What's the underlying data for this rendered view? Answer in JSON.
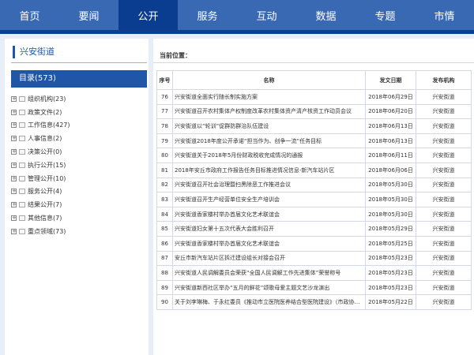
{
  "nav": [
    "首页",
    "要闻",
    "公开",
    "服务",
    "互动",
    "数据",
    "专题",
    "市情"
  ],
  "sidebar": {
    "title": "兴安街道",
    "catalog": "目录(573)",
    "items": [
      "组织机构(23)",
      "政策文件(2)",
      "工作信息(427)",
      "人事信息(2)",
      "决策公开(0)",
      "执行公开(15)",
      "管理公开(10)",
      "服务公开(4)",
      "结果公开(7)",
      "其他信息(7)",
      "重点领域(73)"
    ]
  },
  "main": {
    "crumb": "当前位置：",
    "headers": [
      "序号",
      "名称",
      "发文日期",
      "发布机构"
    ],
    "rows": [
      [
        "76",
        "兴安街道全面实行随长制实施方案",
        "2018年06月29日",
        "兴安街道"
      ],
      [
        "77",
        "兴安街道召开农村集体产权制度改革农村集体资产清产核资工作动员会议",
        "2018年06月20日",
        "兴安街道"
      ],
      [
        "78",
        "兴安街道以“轮训”促群防群治队伍建设",
        "2018年06月13日",
        "兴安街道"
      ],
      [
        "79",
        "兴安街道2018年度公开承诺“担当作为、创争一流”任务目标",
        "2018年06月13日",
        "兴安街道"
      ],
      [
        "80",
        "兴安街道关于2018年5月份财政税收完成情况的通报",
        "2018年06月11日",
        "兴安街道"
      ],
      [
        "81",
        "2018年安丘市政府工作报告任务目标推进情况信息-新汽车站片区",
        "2018年06月06日",
        "兴安街道"
      ],
      [
        "82",
        "兴安街道召开社会治理暨扫黑除恶工作推进会议",
        "2018年05月30日",
        "兴安街道"
      ],
      [
        "83",
        "兴安街道召开生产经营单位安全生产培训会",
        "2018年05月30日",
        "兴安街道"
      ],
      [
        "84",
        "兴安街道香家楼村举办首届文化艺术联谊会",
        "2018年05月30日",
        "兴安街道"
      ],
      [
        "85",
        "兴安街道妇女第十五次代表大会胜利召开",
        "2018年05月29日",
        "兴安街道"
      ],
      [
        "86",
        "兴安街道香家楼村举办首届文化艺术联谊会",
        "2018年05月25日",
        "兴安街道"
      ],
      [
        "87",
        "安丘市新汽车站片区拆迁建设组长对接会召开",
        "2018年05月23日",
        "兴安街道"
      ],
      [
        "88",
        "兴安街道人民调解委员会荣获“全国人民调解工作先进集体”荣誉称号",
        "2018年05月23日",
        "兴安街道"
      ],
      [
        "89",
        "兴安街道新西社区举办“五月的鲜花”颂歌母爱主题文艺沙龙演出",
        "2018年05月23日",
        "兴安街道"
      ],
      [
        "90",
        "关于刘李琳梅、于永红委员《推动市立医院医养结合型医院建设》（市政协十届...",
        "2018年05月22日",
        "兴安街道"
      ]
    ]
  }
}
